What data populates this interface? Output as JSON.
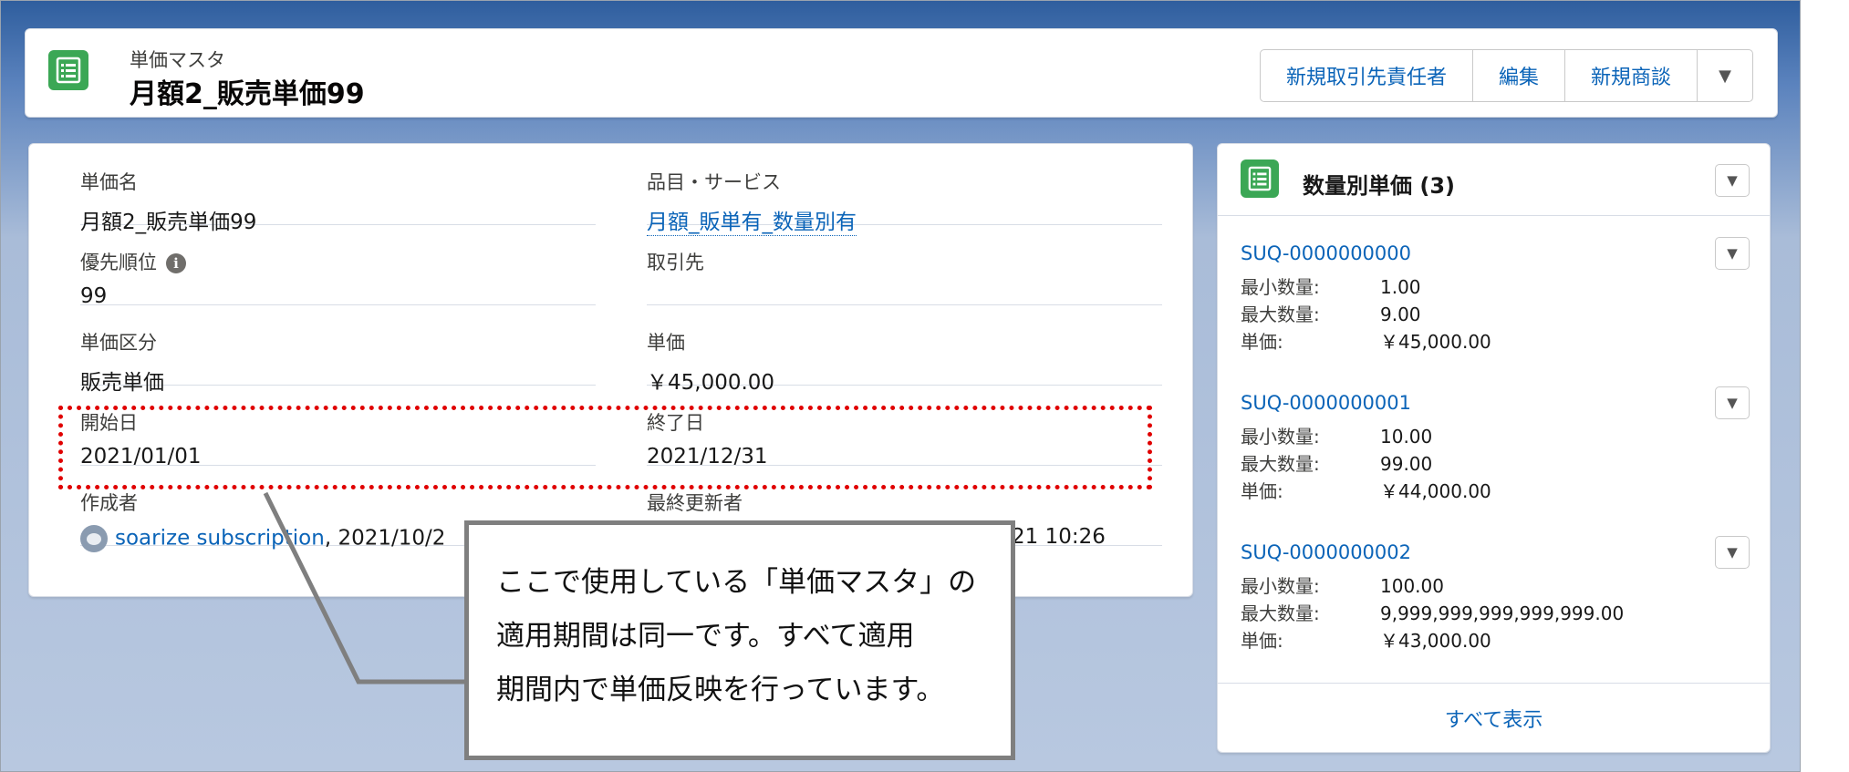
{
  "header": {
    "object_label": "単価マスタ",
    "record_name": "月額2_販売単価99",
    "buttons": [
      "新規取引先責任者",
      "編集",
      "新規商談"
    ],
    "more_icon": "▼"
  },
  "details": {
    "fields": {
      "name": {
        "label": "単価名",
        "value": "月額2_販売単価99"
      },
      "product": {
        "label": "品目・サービス",
        "value": "月額_販単有_数量別有"
      },
      "priority": {
        "label": "優先順位",
        "value": "99",
        "info_icon": "i"
      },
      "account": {
        "label": "取引先",
        "value": ""
      },
      "price_type": {
        "label": "単価区分",
        "value": "販売単価"
      },
      "unit_price": {
        "label": "単価",
        "value": "￥45,000.00"
      },
      "start_date": {
        "label": "開始日",
        "value": "2021/01/01"
      },
      "end_date": {
        "label": "終了日",
        "value": "2021/12/31"
      },
      "created_by": {
        "label": "作成者",
        "user": "soarize subscription",
        "date": ", 2021/10/2"
      },
      "modified_by": {
        "label": "最終更新者",
        "date": "21 10:26"
      }
    }
  },
  "related": {
    "title": "数量別単価 (3)",
    "records": [
      {
        "name": "SUQ-0000000000",
        "min_label": "最小数量:",
        "min": "1.00",
        "max_label": "最大数量:",
        "max": "9.00",
        "price_label": "単価:",
        "price": "￥45,000.00"
      },
      {
        "name": "SUQ-0000000001",
        "min_label": "最小数量:",
        "min": "10.00",
        "max_label": "最大数量:",
        "max": "99.00",
        "price_label": "単価:",
        "price": "￥44,000.00"
      },
      {
        "name": "SUQ-0000000002",
        "min_label": "最小数量:",
        "min": "100.00",
        "max_label": "最大数量:",
        "max": "9,999,999,999,999,999.00",
        "price_label": "単価:",
        "price": "￥43,000.00"
      }
    ],
    "view_all": "すべて表示"
  },
  "annotation": {
    "lines": [
      "ここで使用している「単価マスタ」の",
      "適用期間は同一です。すべて適用",
      "期間内で単価反映を行っています。"
    ],
    "highlight_color": "#e00000"
  },
  "colors": {
    "link": "#0b64b8",
    "object_icon": "#3ba755",
    "brand_bg": "#2f5e9e"
  }
}
